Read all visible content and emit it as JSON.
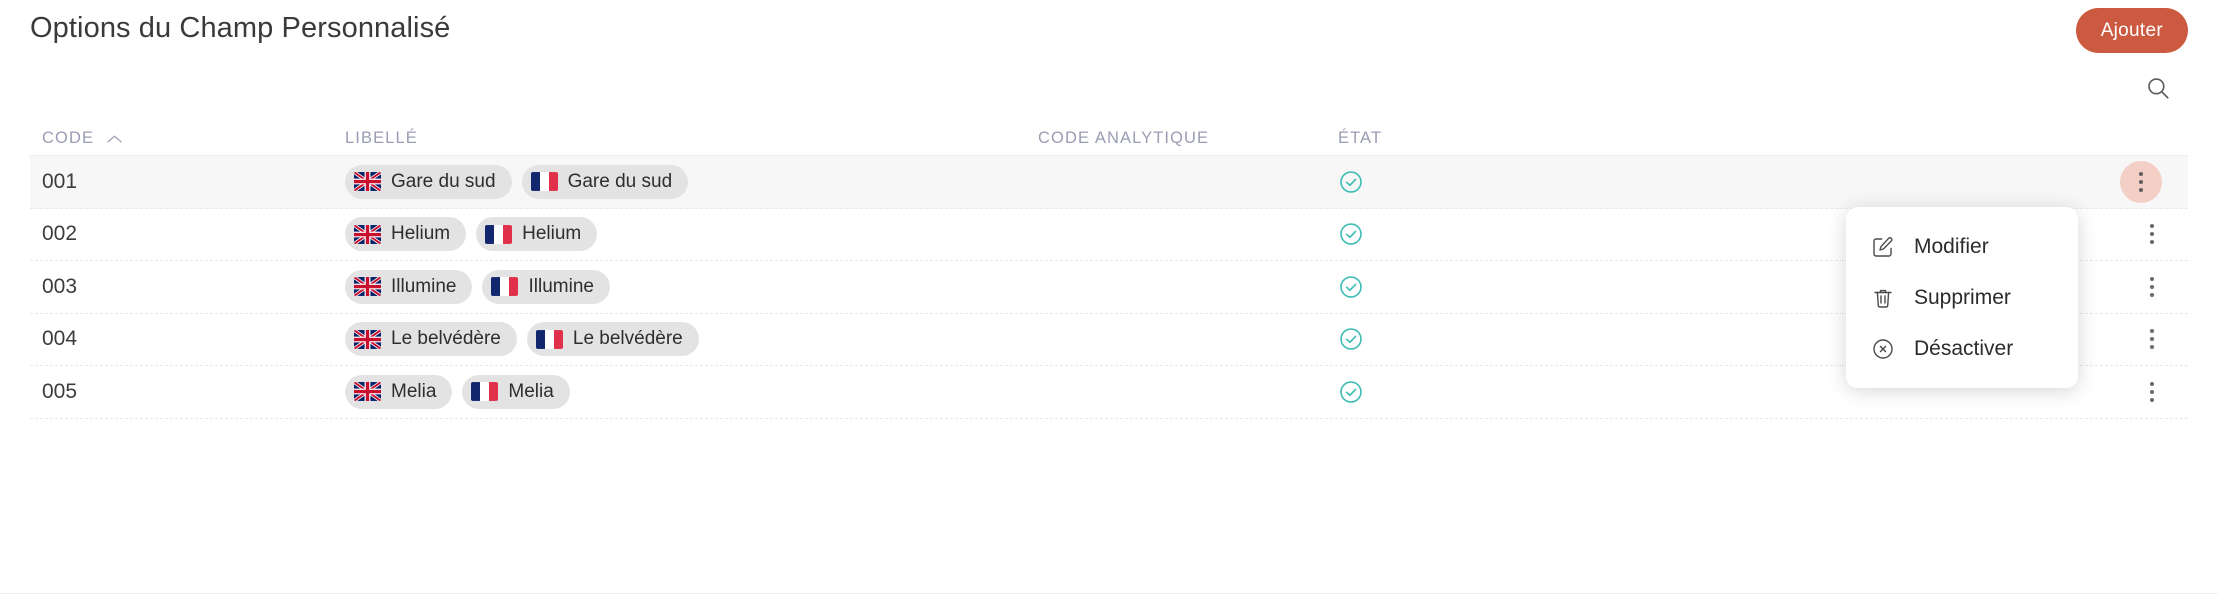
{
  "header": {
    "title": "Options du Champ Personnalisé",
    "add_label": "Ajouter",
    "search_icon": "search-icon"
  },
  "colors": {
    "accent": "#cb5a41",
    "status_ok": "#3fbdb4",
    "chip_bg": "#e3e3e3",
    "header_text": "#9a9db3",
    "kebab_active_bg": "#f3cfc5"
  },
  "table": {
    "columns": [
      {
        "key": "code",
        "label": "CODE",
        "sorted": "asc",
        "sort_icon": "chevron-up-icon"
      },
      {
        "key": "libelle",
        "label": "LIBELLÉ"
      },
      {
        "key": "code_analytique",
        "label": "CODE ANALYTIQUE"
      },
      {
        "key": "etat",
        "label": "ÉTAT"
      }
    ],
    "rows": [
      {
        "code": "001",
        "labels": [
          {
            "flag": "flag-uk",
            "text": "Gare du sud"
          },
          {
            "flag": "flag-fr",
            "text": "Gare du sud"
          }
        ],
        "code_analytique": "",
        "etat": "actif",
        "selected": true
      },
      {
        "code": "002",
        "labels": [
          {
            "flag": "flag-uk",
            "text": "Helium"
          },
          {
            "flag": "flag-fr",
            "text": "Helium"
          }
        ],
        "code_analytique": "",
        "etat": "actif",
        "selected": false
      },
      {
        "code": "003",
        "labels": [
          {
            "flag": "flag-uk",
            "text": "Illumine"
          },
          {
            "flag": "flag-fr",
            "text": "Illumine"
          }
        ],
        "code_analytique": "",
        "etat": "actif",
        "selected": false
      },
      {
        "code": "004",
        "labels": [
          {
            "flag": "flag-uk",
            "text": "Le belvédère"
          },
          {
            "flag": "flag-fr",
            "text": "Le belvédère"
          }
        ],
        "code_analytique": "",
        "etat": "actif",
        "selected": false
      },
      {
        "code": "005",
        "labels": [
          {
            "flag": "flag-uk",
            "text": "Melia"
          },
          {
            "flag": "flag-fr",
            "text": "Melia"
          }
        ],
        "code_analytique": "",
        "etat": "actif",
        "selected": false
      }
    ]
  },
  "context_menu": {
    "open": true,
    "items": [
      {
        "icon": "edit-pencil-icon",
        "label": "Modifier"
      },
      {
        "icon": "trash-icon",
        "label": "Supprimer"
      },
      {
        "icon": "circle-x-icon",
        "label": "Désactiver"
      }
    ]
  }
}
